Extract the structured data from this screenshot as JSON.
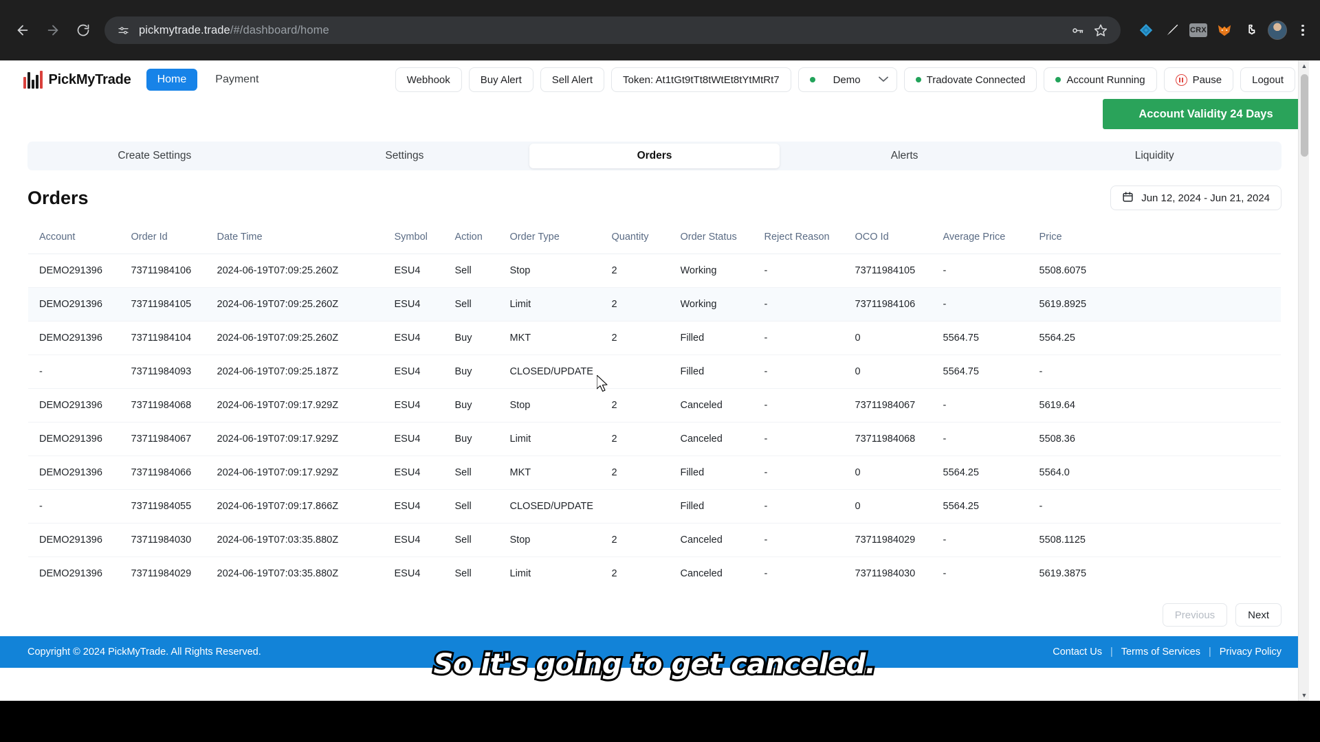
{
  "browser": {
    "back_icon": "back-arrow-icon",
    "forward_icon": "forward-arrow-icon",
    "reload_icon": "reload-icon",
    "site_info_icon": "site-settings-icon",
    "url_domain": "pickmytrade.trade",
    "url_path": "/#/dashboard/home",
    "password_icon": "password-key-icon",
    "bookmark_icon": "bookmark-star-icon",
    "extensions": [
      "web3-wallet-icon",
      "paint-brush-icon",
      "crx-icon",
      "metamask-fox-icon",
      "extensions-puzzle-icon"
    ],
    "crx_label": "CRX",
    "avatar_icon": "profile-avatar",
    "menu_icon": "three-dot-menu-icon"
  },
  "header": {
    "brand": "PickMyTrade",
    "brand_logo_icon": "candlestick-logo-icon",
    "nav": [
      {
        "label": "Home",
        "active": true
      },
      {
        "label": "Payment",
        "active": false
      }
    ],
    "actions": {
      "webhook": "Webhook",
      "buy_alert": "Buy Alert",
      "sell_alert": "Sell Alert",
      "token": "Token: At1tGt9tTt8tWtEt8tYtMtRt7",
      "account_mode": "Demo",
      "broker_status": "Tradovate Connected",
      "account_status": "Account Running",
      "pause": "Pause",
      "logout": "Logout"
    },
    "colors": {
      "accent": "#1783e8",
      "status_green": "#22a35a",
      "pause_red": "#e0453f"
    }
  },
  "validity_banner": {
    "label": "Account Validity 24 Days",
    "color": "#2aa35a"
  },
  "tabs": [
    {
      "label": "Create Settings",
      "active": false
    },
    {
      "label": "Settings",
      "active": false
    },
    {
      "label": "Orders",
      "active": true
    },
    {
      "label": "Alerts",
      "active": false
    },
    {
      "label": "Liquidity",
      "active": false
    }
  ],
  "orders_section": {
    "title": "Orders",
    "date_range": "Jun 12, 2024 - Jun 21, 2024",
    "calendar_icon": "calendar-icon",
    "columns": [
      "Account",
      "Order Id",
      "Date Time",
      "Symbol",
      "Action",
      "Order Type",
      "Quantity",
      "Order Status",
      "Reject Reason",
      "OCO Id",
      "Average Price",
      "Price"
    ],
    "rows": [
      {
        "account": "DEMO291396",
        "order_id": "73711984106",
        "date_time": "2024-06-19T07:09:25.260Z",
        "symbol": "ESU4",
        "action": "Sell",
        "order_type": "Stop",
        "quantity": "2",
        "order_status": "Working",
        "reject_reason": "-",
        "oco_id": "73711984105",
        "average_price": "-",
        "price": "5508.6075",
        "hovered": false
      },
      {
        "account": "DEMO291396",
        "order_id": "73711984105",
        "date_time": "2024-06-19T07:09:25.260Z",
        "symbol": "ESU4",
        "action": "Sell",
        "order_type": "Limit",
        "quantity": "2",
        "order_status": "Working",
        "reject_reason": "-",
        "oco_id": "73711984106",
        "average_price": "-",
        "price": "5619.8925",
        "hovered": true
      },
      {
        "account": "DEMO291396",
        "order_id": "73711984104",
        "date_time": "2024-06-19T07:09:25.260Z",
        "symbol": "ESU4",
        "action": "Buy",
        "order_type": "MKT",
        "quantity": "2",
        "order_status": "Filled",
        "reject_reason": "-",
        "oco_id": "0",
        "average_price": "5564.75",
        "price": "5564.25",
        "hovered": false
      },
      {
        "account": "-",
        "order_id": "73711984093",
        "date_time": "2024-06-19T07:09:25.187Z",
        "symbol": "ESU4",
        "action": "Buy",
        "order_type": "CLOSED/UPDATE",
        "quantity": "",
        "order_status": "Filled",
        "reject_reason": "-",
        "oco_id": "0",
        "average_price": "5564.75",
        "price": "-",
        "hovered": false
      },
      {
        "account": "DEMO291396",
        "order_id": "73711984068",
        "date_time": "2024-06-19T07:09:17.929Z",
        "symbol": "ESU4",
        "action": "Buy",
        "order_type": "Stop",
        "quantity": "2",
        "order_status": "Canceled",
        "reject_reason": "-",
        "oco_id": "73711984067",
        "average_price": "-",
        "price": "5619.64",
        "hovered": false
      },
      {
        "account": "DEMO291396",
        "order_id": "73711984067",
        "date_time": "2024-06-19T07:09:17.929Z",
        "symbol": "ESU4",
        "action": "Buy",
        "order_type": "Limit",
        "quantity": "2",
        "order_status": "Canceled",
        "reject_reason": "-",
        "oco_id": "73711984068",
        "average_price": "-",
        "price": "5508.36",
        "hovered": false
      },
      {
        "account": "DEMO291396",
        "order_id": "73711984066",
        "date_time": "2024-06-19T07:09:17.929Z",
        "symbol": "ESU4",
        "action": "Sell",
        "order_type": "MKT",
        "quantity": "2",
        "order_status": "Filled",
        "reject_reason": "-",
        "oco_id": "0",
        "average_price": "5564.25",
        "price": "5564.0",
        "hovered": false
      },
      {
        "account": "-",
        "order_id": "73711984055",
        "date_time": "2024-06-19T07:09:17.866Z",
        "symbol": "ESU4",
        "action": "Sell",
        "order_type": "CLOSED/UPDATE",
        "quantity": "",
        "order_status": "Filled",
        "reject_reason": "-",
        "oco_id": "0",
        "average_price": "5564.25",
        "price": "-",
        "hovered": false
      },
      {
        "account": "DEMO291396",
        "order_id": "73711984030",
        "date_time": "2024-06-19T07:03:35.880Z",
        "symbol": "ESU4",
        "action": "Sell",
        "order_type": "Stop",
        "quantity": "2",
        "order_status": "Canceled",
        "reject_reason": "-",
        "oco_id": "73711984029",
        "average_price": "-",
        "price": "5508.1125",
        "hovered": false
      },
      {
        "account": "DEMO291396",
        "order_id": "73711984029",
        "date_time": "2024-06-19T07:03:35.880Z",
        "symbol": "ESU4",
        "action": "Sell",
        "order_type": "Limit",
        "quantity": "2",
        "order_status": "Canceled",
        "reject_reason": "-",
        "oco_id": "73711984030",
        "average_price": "-",
        "price": "5619.3875",
        "hovered": false
      }
    ],
    "pagination": {
      "previous": "Previous",
      "next": "Next",
      "previous_disabled": true
    }
  },
  "footer": {
    "copyright": "Copyright © 2024 PickMyTrade. All Rights Reserved.",
    "links": [
      "Contact Us",
      "Terms of Services",
      "Privacy Policy"
    ],
    "background": "#1283d8"
  },
  "caption": {
    "text": "So it's going to get canceled."
  }
}
